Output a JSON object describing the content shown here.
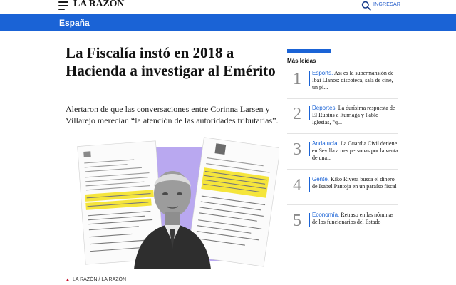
{
  "header": {
    "logo": "LA RAZÓN",
    "login_label": "INGRESAR",
    "menu_icon": "hamburger-menu-icon",
    "search_icon": "search-icon"
  },
  "section": {
    "name": "España"
  },
  "article": {
    "headline": "La Fiscalía instó en 2018 a Hacienda a investigar al Emérito",
    "subtitle": "Alertaron de que las conversaciones entre Corinna Larsen y Villarejo merecían “la atención de las autoridades tributarias”.",
    "image_caption": "LA RAZÓN / LA RAZÓN"
  },
  "sidebar": {
    "title": "Más leídas",
    "items": [
      {
        "number": "1",
        "category": "Esports.",
        "text": " Así es la supermansión de Ibai Llanos: discoteca, sala de cine, un pi..."
      },
      {
        "number": "2",
        "category": "Deportes.",
        "text": " La durísima respuesta de El Rubius a Iturriaga y Pablo Iglesias, “q..."
      },
      {
        "number": "3",
        "category": "Andalucía.",
        "text": " La Guardia Civil detiene en Sevilla a tres personas por la venta de una..."
      },
      {
        "number": "4",
        "category": "Gente.",
        "text": " Kiko Rivera busca el dinero de Isabel Pantoja en un paraíso fiscal"
      },
      {
        "number": "5",
        "category": "Economía.",
        "text": " Retraso en las nóminas de los funcionarios del Estado"
      }
    ]
  },
  "colors": {
    "brand_blue": "#1a63d6",
    "caption_red": "#c8102e",
    "highlight_yellow": "#f5e53b",
    "image_purple": "#b9a8f0"
  }
}
